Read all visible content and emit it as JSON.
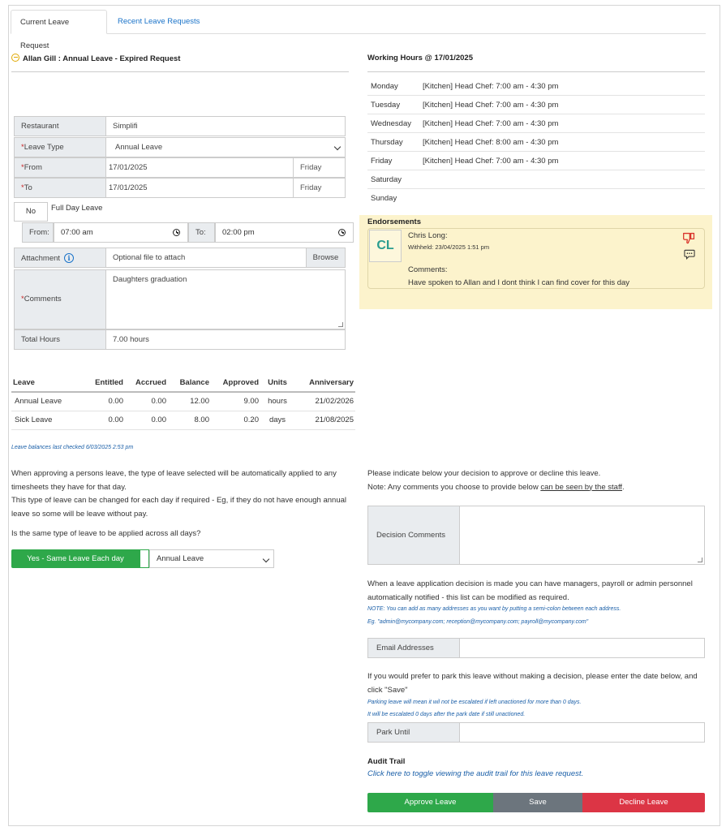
{
  "tabs": {
    "current": "Current Leave Request",
    "recent": "Recent Leave Requests"
  },
  "request": {
    "title": "Allan Gill : Annual Leave - Expired Request",
    "restaurant_label": "Restaurant",
    "restaurant_value": "Simplifi",
    "leave_type_label": "Leave Type",
    "leave_type_value": "Annual Leave",
    "from_label": "From",
    "from_date": "17/01/2025",
    "from_day": "Friday",
    "to_label": "To",
    "to_date": "17/01/2025",
    "to_day": "Friday",
    "full_day_toggle": "No",
    "full_day_label": "Full Day Leave",
    "time_from_label": "From:",
    "time_from_value": "07:00 am",
    "time_to_label": "To:",
    "time_to_value": "02:00 pm",
    "attachment_label": "Attachment",
    "attachment_placeholder": "Optional file to attach",
    "browse_label": "Browse",
    "comments_label": "Comments",
    "comments_value": "Daughters graduation",
    "total_hours_label": "Total Hours",
    "total_hours_value": "7.00 hours",
    "required_mark": "*"
  },
  "balances": {
    "headers": [
      "Leave",
      "Entitled",
      "Accrued",
      "Balance",
      "Approved",
      "Units",
      "Anniversary"
    ],
    "rows": [
      [
        "Annual Leave",
        "0.00",
        "0.00",
        "12.00",
        "9.00",
        "hours",
        "21/02/2026"
      ],
      [
        "Sick Leave",
        "0.00",
        "0.00",
        "8.00",
        "0.20",
        "days",
        "21/08/2025"
      ]
    ],
    "note": "Leave balances last checked 6/03/2025 2:53 pm"
  },
  "apply_all": {
    "para1": "When approving a persons leave, the type of leave selected will be automatically applied to any timesheets they have for that day.",
    "para2": "This type of leave can be changed for each day if required - Eg, if they do not have enough annual leave so some will be leave without pay.",
    "question": "Is the same type of leave to be applied across all days?",
    "toggle_label": "Yes - Same Leave Each day",
    "select_value": "Annual Leave"
  },
  "working_hours": {
    "title": "Working Hours @ 17/01/2025",
    "days": [
      {
        "day": "Monday",
        "shift": "[Kitchen] Head Chef: 7:00 am - 4:30 pm"
      },
      {
        "day": "Tuesday",
        "shift": "[Kitchen] Head Chef: 7:00 am - 4:30 pm"
      },
      {
        "day": "Wednesday",
        "shift": "[Kitchen] Head Chef: 7:00 am - 4:30 pm"
      },
      {
        "day": "Thursday",
        "shift": "[Kitchen] Head Chef: 8:00 am - 4:30 pm"
      },
      {
        "day": "Friday",
        "shift": "[Kitchen] Head Chef: 7:00 am - 4:30 pm"
      },
      {
        "day": "Saturday",
        "shift": ""
      },
      {
        "day": "Sunday",
        "shift": ""
      }
    ]
  },
  "endorsements": {
    "title": "Endorsements",
    "initials": "CL",
    "name": "Chris Long:",
    "status": "Withheld: 23/04/2025 1:51 pm",
    "comments_label": "Comments:",
    "comment": "Have spoken to Allan and I dont think I can find cover for this day",
    "colors": {
      "background": "#fcf3cc",
      "thumb_down": "#d9342b",
      "initials": "#2a9d8f"
    },
    "icons": [
      "thumbs-down-icon",
      "comment-icon"
    ]
  },
  "decision": {
    "intro1": "Please indicate below your decision to approve or decline this leave.",
    "intro2_prefix": "Note: Any comments you choose to provide below ",
    "intro2_link": "can be seen by the staff",
    "intro2_suffix": ".",
    "comments_label": "Decision Comments",
    "notify_para": "When a leave application decision is made you can have managers, payroll or admin personnel automatically notified - this list can be modified as required.",
    "notify_note1": "NOTE: You can add as many addresses as you want by putting a semi-colon between each address.",
    "notify_note2": "Eg. \"admin@mycompany.com; reception@mycompany.com; payroll@mycompany.com\"",
    "email_label": "Email Addresses",
    "park_para": "If you would prefer to park this leave without making a decision, please enter the date below, and click \"Save\"",
    "park_note1": "Parking leave will mean it wil not be escalated if left unactioned for more than 0 days.",
    "park_note2": "It will be escalated 0 days after the park date if still unactioned.",
    "park_label": "Park Until",
    "audit_title": "Audit Trail",
    "audit_link": "Click here to toggle viewing the audit trail for this leave request."
  },
  "actions": {
    "approve": "Approve Leave",
    "save": "Save",
    "decline": "Decline Leave",
    "colors": {
      "approve": "#2ea84a",
      "save": "#6c757d",
      "decline": "#dc3545"
    }
  }
}
